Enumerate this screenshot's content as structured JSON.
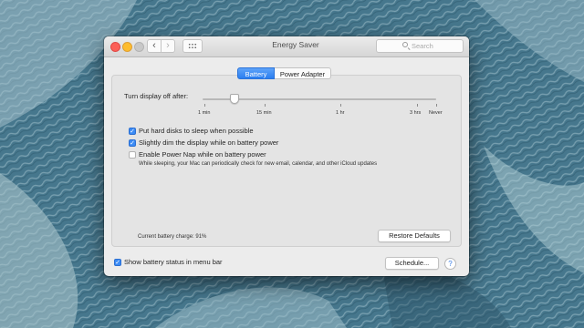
{
  "window": {
    "title": "Energy Saver",
    "search_placeholder": "Search",
    "nav_back": "‹",
    "nav_forward": "›"
  },
  "tabs": [
    {
      "label": "Battery",
      "selected": true
    },
    {
      "label": "Power Adapter",
      "selected": false
    }
  ],
  "display_sleep": {
    "label": "Turn display off after:",
    "ticks": [
      "1 min",
      "15 min",
      "1 hr",
      "3 hrs",
      "Never"
    ],
    "selected_value": "2 min"
  },
  "options": [
    {
      "label": "Put hard disks to sleep when possible",
      "checked": true
    },
    {
      "label": "Slightly dim the display while on battery power",
      "checked": true
    },
    {
      "label": "Enable Power Nap while on battery power",
      "checked": false,
      "description": "While sleeping, your Mac can periodically check for new email, calendar, and other iCloud updates"
    }
  ],
  "battery_charge": "Current battery charge: 91%",
  "buttons": {
    "restore_defaults": "Restore Defaults",
    "schedule": "Schedule...",
    "help": "?"
  },
  "show_battery_status": {
    "label": "Show battery status in menu bar",
    "checked": true
  },
  "check_glyph": "✓",
  "colors": {
    "accent": "#3b8bf5",
    "window_bg": "#ececec"
  }
}
